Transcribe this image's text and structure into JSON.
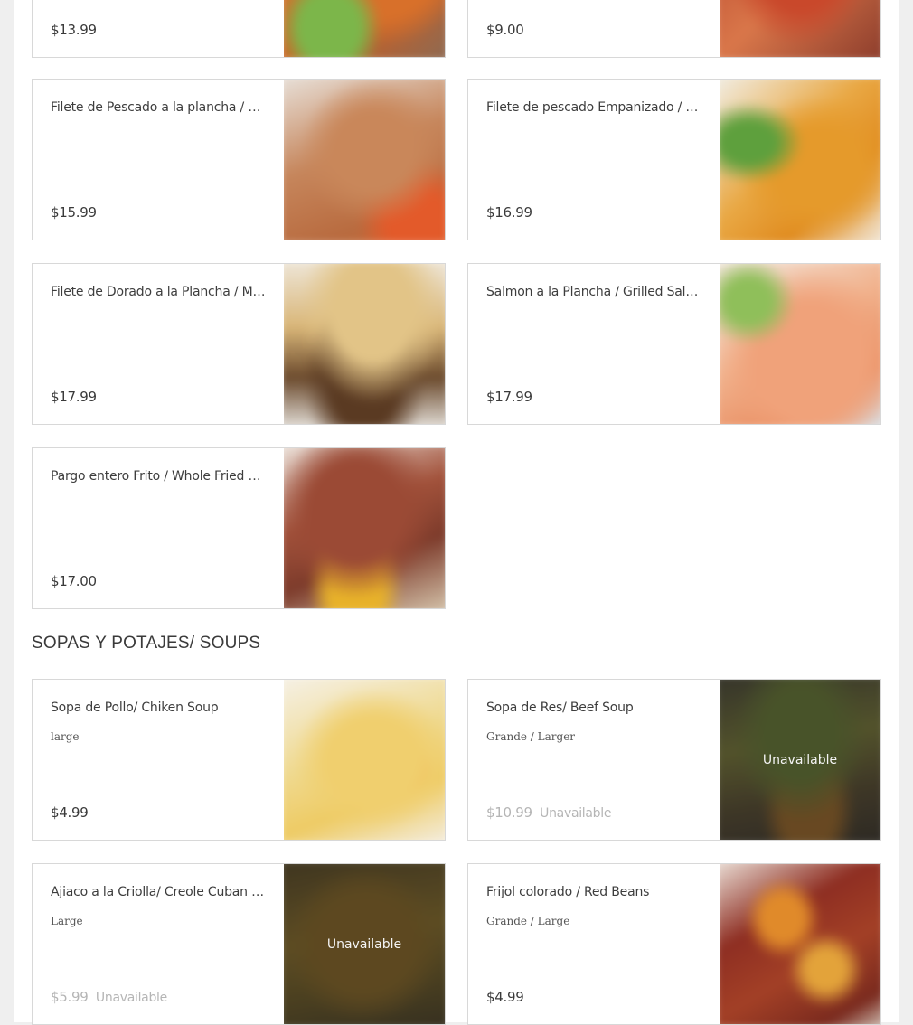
{
  "cards_top": [
    {
      "price": "$13.99",
      "image_icon": "burger-photo",
      "class": "img-burger"
    },
    {
      "price": "$9.00",
      "image_icon": "red-dish-photo",
      "class": "img-red"
    }
  ],
  "fish_items": [
    {
      "title": "Filete de Pescado a la plancha / Fish ...",
      "price": "$15.99",
      "image_icon": "grilled-fish-photo"
    },
    {
      "title": "Filete de pescado Empanizado / Bre...",
      "price": "$16.99",
      "image_icon": "breaded-fish-photo"
    },
    {
      "title": "Filete de Dorado a la Plancha / Mahi...",
      "price": "$17.99",
      "image_icon": "mahi-photo"
    },
    {
      "title": "Salmon a la Plancha / Grilled Salmon",
      "price": "$17.99",
      "image_icon": "salmon-photo"
    },
    {
      "title": "Pargo entero Frito / Whole Fried Sn...",
      "price": "$17.00",
      "image_icon": "snapper-photo"
    }
  ],
  "soups_section": {
    "title": "SOPAS Y POTAJES/ SOUPS",
    "items": [
      {
        "title": "Sopa de Pollo/ Chiken Soup",
        "desc": "large",
        "price": "$4.99",
        "unavailable": false,
        "image_icon": "chicken-soup-photo"
      },
      {
        "title": "Sopa de Res/ Beef Soup",
        "desc": "Grande / Larger",
        "price": "$10.99",
        "unavailable": true,
        "unavailable_label": "Unavailable",
        "overlay_label": "Unavailable",
        "image_icon": "beef-soup-photo"
      },
      {
        "title": "Ajiaco a la Criolla/ Creole Cuban So...",
        "desc": "Large",
        "price": "$5.99",
        "unavailable": true,
        "unavailable_label": "Unavailable",
        "overlay_label": "Unavailable",
        "image_icon": "ajiaco-photo"
      },
      {
        "title": "Frijol colorado / Red Beans",
        "desc": "Grande / Large",
        "price": "$4.99",
        "unavailable": false,
        "image_icon": "red-beans-photo"
      }
    ]
  },
  "colors": {
    "background": "#efefef",
    "card_border": "#d8d8d8",
    "text": "#3a3a3a",
    "unavailable_text": "#b5b5b5"
  }
}
